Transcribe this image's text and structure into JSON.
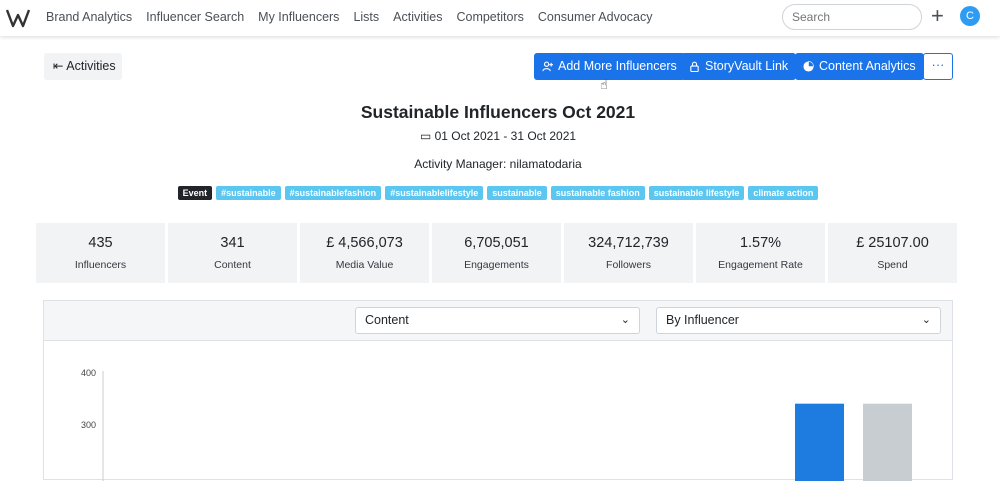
{
  "nav": {
    "items": [
      "Brand Analytics",
      "Influencer Search",
      "My Influencers",
      "Lists",
      "Activities",
      "Competitors",
      "Consumer Advocacy"
    ],
    "search_placeholder": "Search",
    "avatar_letter": "C"
  },
  "toolbar": {
    "back_label": "Activities",
    "add_label": "Add More Influencers",
    "storyvault_label": "StoryVault Link",
    "content_analytics_label": "Content Analytics",
    "more_label": "···"
  },
  "activity": {
    "title": "Sustainable Influencers Oct 2021",
    "date_range": "01 Oct 2021 - 31 Oct 2021",
    "manager": "Activity Manager: nilamatodaria",
    "tags": [
      "Event",
      "#sustainable",
      "#sustainablefashion",
      "#sustainablelifestyle",
      "sustainable",
      "sustainable fashion",
      "sustainable lifestyle",
      "climate action"
    ]
  },
  "stats": [
    {
      "value": "435",
      "label": "Influencers"
    },
    {
      "value": "341",
      "label": "Content"
    },
    {
      "value": "£ 4,566,073",
      "label": "Media Value"
    },
    {
      "value": "6,705,051",
      "label": "Engagements"
    },
    {
      "value": "324,712,739",
      "label": "Followers"
    },
    {
      "value": "1.57%",
      "label": "Engagement Rate"
    },
    {
      "value": "£ 25107.00",
      "label": "Spend"
    }
  ],
  "panel": {
    "metric_select": "Content",
    "group_select": "By Influencer"
  },
  "colors": {
    "primary": "#1a73e8",
    "tag": "#5bc6f0",
    "bar_blue": "#1e7be0",
    "bar_gray": "#c8cdd2"
  },
  "chart_data": {
    "type": "bar",
    "yticks": [
      400,
      300
    ],
    "series": [
      {
        "values": [
          341
        ]
      },
      {
        "values": [
          341
        ]
      }
    ]
  }
}
